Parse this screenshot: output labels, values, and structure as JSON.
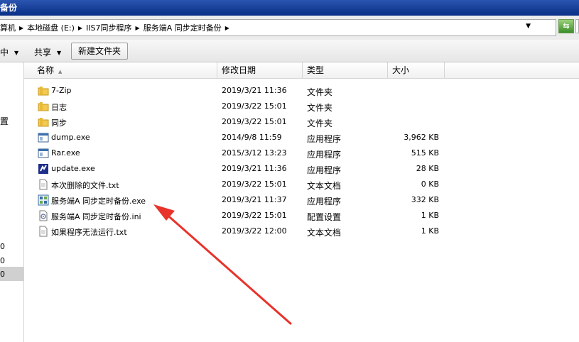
{
  "window": {
    "title_fragment": "备份"
  },
  "address": {
    "crumbs": [
      "算机",
      "本地磁盘 (E:)",
      "IIS7同步程序",
      "服务端A 同步定时备份"
    ],
    "refresh_icon": "refresh-icon"
  },
  "toolbar": {
    "left_fragment": "中",
    "share_label": "共享",
    "new_folder_label": "新建文件夹"
  },
  "navpane": {
    "fragments": [
      "置",
      "0",
      "0",
      "0"
    ]
  },
  "columns": {
    "name": "名称",
    "date": "修改日期",
    "type": "类型",
    "size": "大小"
  },
  "files": [
    {
      "name": "7-Zip",
      "date": "2019/3/21 11:36",
      "type": "文件夹",
      "size": "",
      "icon": "folder-icon"
    },
    {
      "name": "日志",
      "date": "2019/3/22 15:01",
      "type": "文件夹",
      "size": "",
      "icon": "folder-icon"
    },
    {
      "name": "同步",
      "date": "2019/3/22 15:01",
      "type": "文件夹",
      "size": "",
      "icon": "folder-icon"
    },
    {
      "name": "dump.exe",
      "date": "2014/9/8 11:59",
      "type": "应用程序",
      "size": "3,962 KB",
      "icon": "exe-window-icon"
    },
    {
      "name": "Rar.exe",
      "date": "2015/3/12 13:23",
      "type": "应用程序",
      "size": "515 KB",
      "icon": "exe-window-icon"
    },
    {
      "name": "update.exe",
      "date": "2019/3/21 11:36",
      "type": "应用程序",
      "size": "28 KB",
      "icon": "update-app-icon"
    },
    {
      "name": "本次删除的文件.txt",
      "date": "2019/3/22 15:01",
      "type": "文本文档",
      "size": "0 KB",
      "icon": "text-file-icon"
    },
    {
      "name": "服务端A 同步定时备份.exe",
      "date": "2019/3/21 11:37",
      "type": "应用程序",
      "size": "332 KB",
      "icon": "sync-app-icon"
    },
    {
      "name": "服务端A 同步定时备份.ini",
      "date": "2019/3/22 15:01",
      "type": "配置设置",
      "size": "1 KB",
      "icon": "config-file-icon"
    },
    {
      "name": "如果程序无法运行.txt",
      "date": "2019/3/22 12:00",
      "type": "文本文档",
      "size": "1 KB",
      "icon": "text-file-icon"
    }
  ],
  "annotation": {
    "color": "#e8332b",
    "target_file": "服务端A 同步定时备份.exe"
  }
}
